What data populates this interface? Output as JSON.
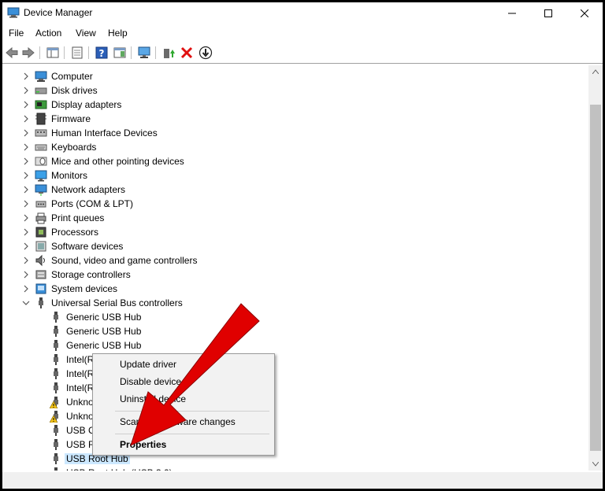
{
  "window": {
    "title": "Device Manager"
  },
  "menu": [
    "File",
    "Action",
    "View",
    "Help"
  ],
  "tree": [
    {
      "label": "Computer",
      "icon": "computer-icon",
      "level": 0,
      "expanded": false
    },
    {
      "label": "Disk drives",
      "icon": "disk-icon",
      "level": 0,
      "expanded": false
    },
    {
      "label": "Display adapters",
      "icon": "display-adapter-icon",
      "level": 0,
      "expanded": false
    },
    {
      "label": "Firmware",
      "icon": "firmware-icon",
      "level": 0,
      "expanded": false
    },
    {
      "label": "Human Interface Devices",
      "icon": "hid-icon",
      "level": 0,
      "expanded": false
    },
    {
      "label": "Keyboards",
      "icon": "keyboard-icon",
      "level": 0,
      "expanded": false
    },
    {
      "label": "Mice and other pointing devices",
      "icon": "mouse-icon",
      "level": 0,
      "expanded": false
    },
    {
      "label": "Monitors",
      "icon": "monitor-icon",
      "level": 0,
      "expanded": false
    },
    {
      "label": "Network adapters",
      "icon": "network-icon",
      "level": 0,
      "expanded": false
    },
    {
      "label": "Ports (COM & LPT)",
      "icon": "port-icon",
      "level": 0,
      "expanded": false
    },
    {
      "label": "Print queues",
      "icon": "printer-icon",
      "level": 0,
      "expanded": false
    },
    {
      "label": "Processors",
      "icon": "processor-icon",
      "level": 0,
      "expanded": false
    },
    {
      "label": "Software devices",
      "icon": "software-icon",
      "level": 0,
      "expanded": false
    },
    {
      "label": "Sound, video and game controllers",
      "icon": "sound-icon",
      "level": 0,
      "expanded": false
    },
    {
      "label": "Storage controllers",
      "icon": "storage-icon",
      "level": 0,
      "expanded": false
    },
    {
      "label": "System devices",
      "icon": "system-icon",
      "level": 0,
      "expanded": false
    },
    {
      "label": "Universal Serial Bus controllers",
      "icon": "usb-icon",
      "level": 0,
      "expanded": true
    },
    {
      "label": "Generic USB Hub",
      "icon": "usb-icon",
      "level": 1
    },
    {
      "label": "Generic USB Hub",
      "icon": "usb-icon",
      "level": 1
    },
    {
      "label": "Generic USB Hub",
      "icon": "usb-icon",
      "level": 1
    },
    {
      "label": "Intel(R",
      "icon": "usb-icon",
      "level": 1
    },
    {
      "label": "Intel(R",
      "icon": "usb-icon",
      "level": 1
    },
    {
      "label": "Intel(R                                                           icrosoft)",
      "icon": "usb-icon",
      "level": 1
    },
    {
      "label": "Unkno                                                           Failed)",
      "icon": "usb-warning-icon",
      "level": 1
    },
    {
      "label": "Unkno                                                           Failed)",
      "icon": "usb-warning-icon",
      "level": 1
    },
    {
      "label": "USB C",
      "icon": "usb-icon",
      "level": 1
    },
    {
      "label": "USB R",
      "icon": "usb-icon",
      "level": 1
    },
    {
      "label": "USB Root Hub",
      "icon": "usb-icon",
      "level": 1,
      "selected": true
    },
    {
      "label": "USB Root Hub (USB 3.0)",
      "icon": "usb-icon",
      "level": 1
    }
  ],
  "context_menu": {
    "items": [
      {
        "label": "Update driver"
      },
      {
        "label": "Disable device"
      },
      {
        "label": "Uninstall device"
      },
      {
        "label": "Scan for hardware changes"
      },
      {
        "label": "Properties",
        "bold": true
      }
    ]
  },
  "colors": {
    "selection": "#cce8ff",
    "annotation_arrow": "#e00000"
  }
}
